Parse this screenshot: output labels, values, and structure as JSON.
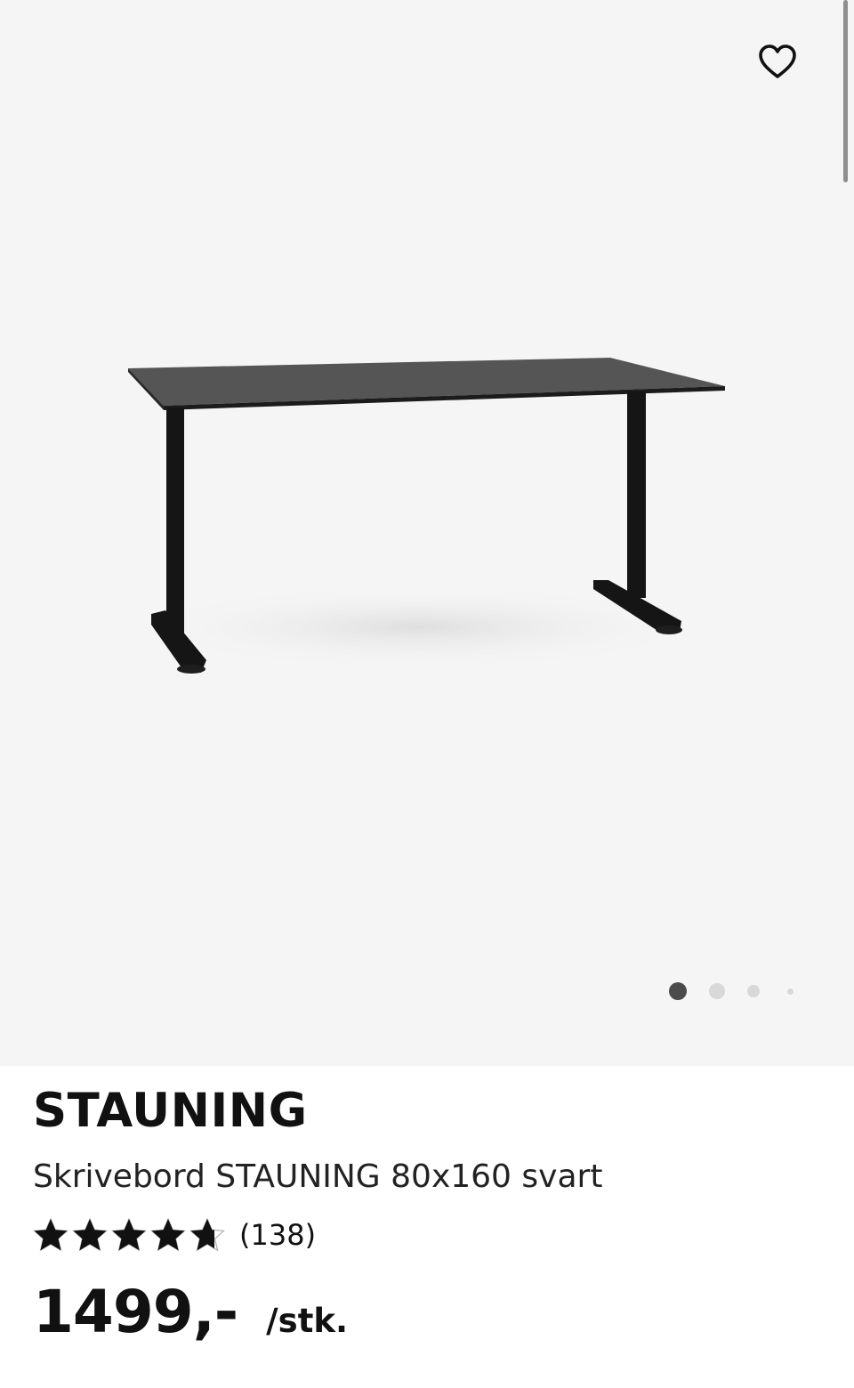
{
  "gallery": {
    "image_name": "black desk on black T-legs",
    "favorite_icon": "heart-outline-icon",
    "active_slide": 1,
    "slide_count": 4
  },
  "product": {
    "brand": "STAUNING",
    "description": "Skrivebord STAUNING 80x160 svart",
    "rating": {
      "stars": 4.7,
      "max_stars": 5,
      "star_icon": "star-icon",
      "count_label": "(138)"
    },
    "price": "1499,-",
    "unit": "/stk."
  },
  "colors": {
    "gallery_bg": "#f5f5f5",
    "text": "#111111",
    "dot_active": "#4b4b4b",
    "dot_inactive": "#d8d8d8"
  }
}
